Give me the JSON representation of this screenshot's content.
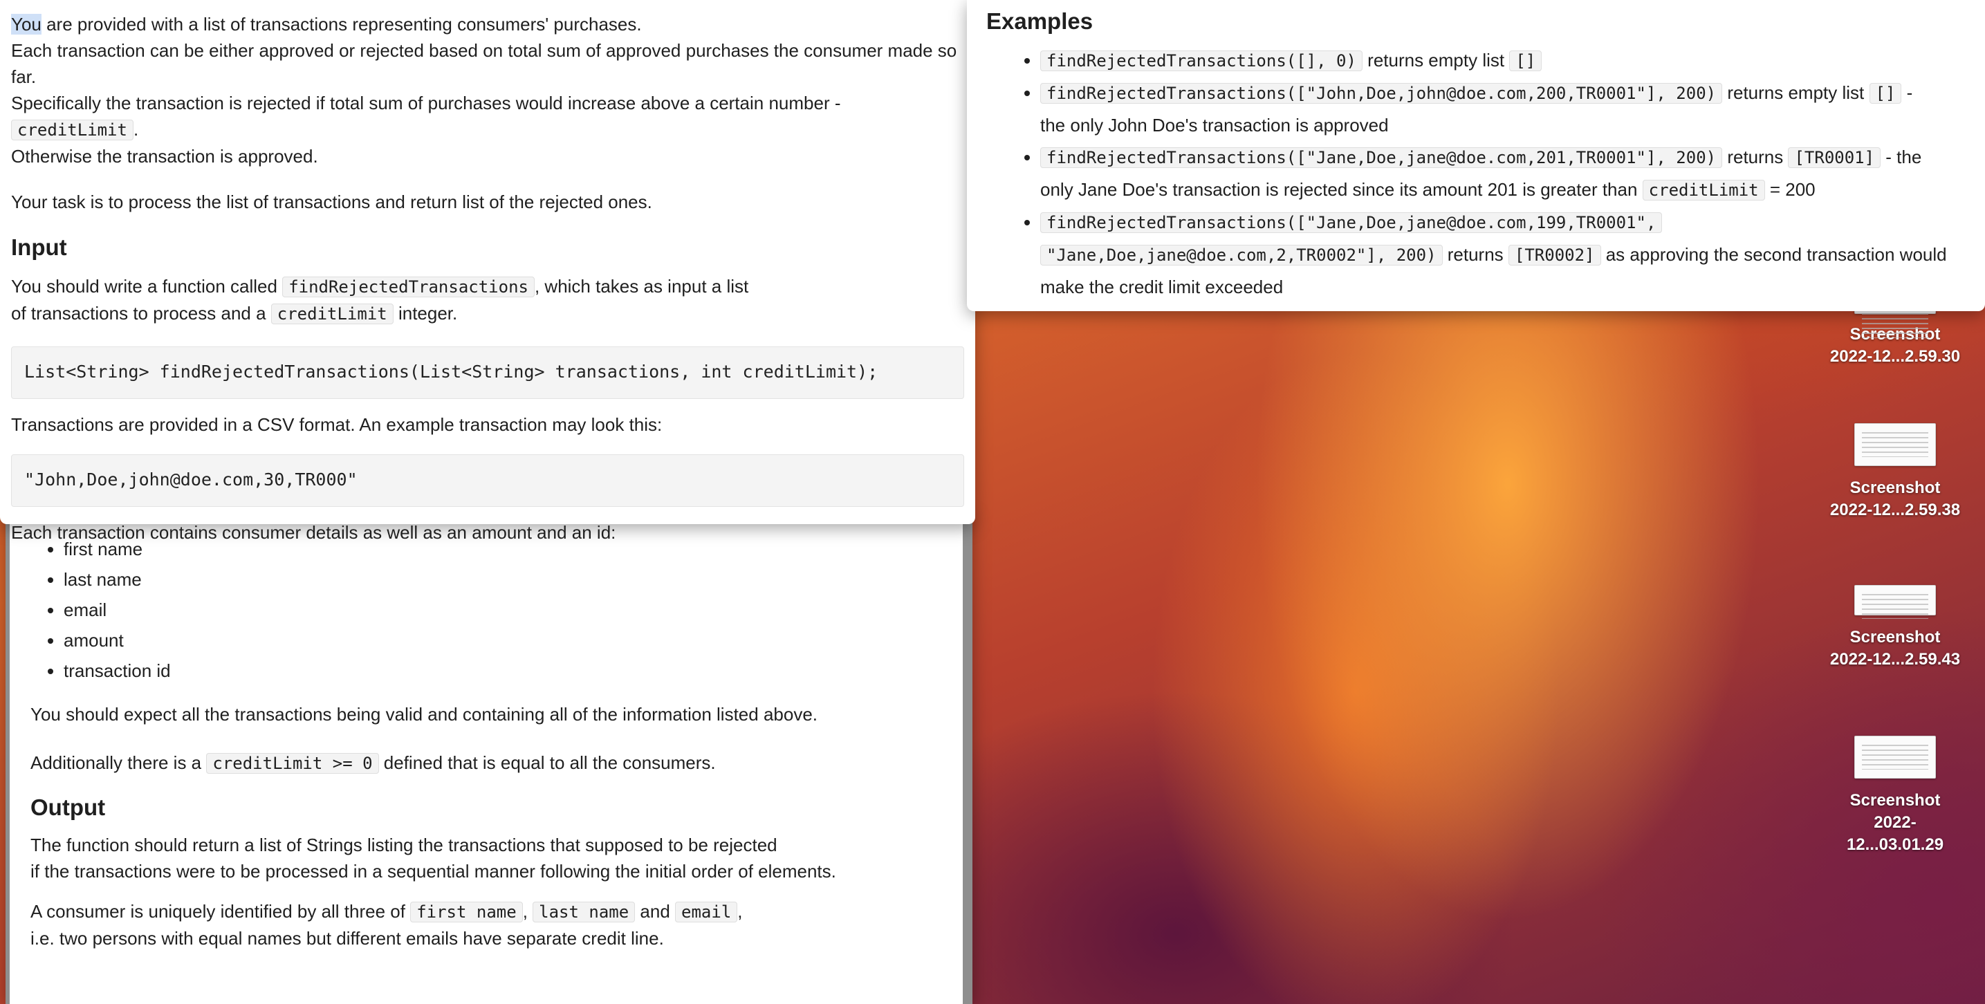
{
  "desktop": {
    "icons": [
      {
        "label_line1": "Screenshot",
        "label_line2": "2022-12...2.59.30"
      },
      {
        "label_line1": "Screenshot",
        "label_line2": "2022-12...2.59.38"
      },
      {
        "label_line1": "Screenshot",
        "label_line2": "2022-12...2.59.43"
      },
      {
        "label_line1": "Screenshot",
        "label_line2": "2022-12...03.01.29"
      }
    ]
  },
  "left": {
    "intro_you": "You",
    "intro_rest": " are provided with a list of transactions representing consumers' purchases.",
    "intro_line2": "Each transaction can be either approved or rejected based on total sum of approved purchases the consumer made so far.",
    "intro_line3_a": "Specifically the transaction is rejected if total sum of purchases would increase above a certain number - ",
    "intro_line3_code": "creditLimit",
    "intro_line3_b": ".",
    "intro_line4": "Otherwise the transaction is approved.",
    "task": "Your task is to process the list of transactions and return list of the rejected ones.",
    "input_heading": "Input",
    "input_line1_a": "You should write a function called ",
    "input_line1_code": "findRejectedTransactions",
    "input_line1_b": ", which takes as input a list",
    "input_line2_a": "of transactions to process and a ",
    "input_line2_code": "creditLimit",
    "input_line2_b": " integer.",
    "signature": "List<String> findRejectedTransactions(List<String> transactions, int creditLimit);",
    "csv_text": "Transactions are provided in a CSV format. An example transaction may look this:",
    "csv_example": "\"John,Doe,john@doe.com,30,TR000\"",
    "details_text": "Each transaction contains consumer details as well as an amount and an id:"
  },
  "back": {
    "fields": [
      "first name",
      "last name",
      "email",
      "amount",
      "transaction id"
    ],
    "valid_text": "You should expect all the transactions being valid and containing all of the information listed above.",
    "limit_a": "Additionally there is a ",
    "limit_code": "creditLimit >= 0",
    "limit_b": " defined that is equal to all the consumers.",
    "output_heading": "Output",
    "output_line1": "The function should return a list of Strings listing the transactions that supposed to be rejected",
    "output_line2": "if the transactions were to be processed in a sequential manner following the initial order of elements.",
    "consumer_a": "A consumer is uniquely identified by all three of ",
    "consumer_code1": "first name",
    "consumer_sep1": ", ",
    "consumer_code2": "last name",
    "consumer_and": " and ",
    "consumer_code3": "email",
    "consumer_b": ",",
    "consumer_line2": "i.e. two persons with equal names but different emails have separate credit line."
  },
  "right": {
    "heading": "Examples",
    "ex1_code": "findRejectedTransactions([], 0)",
    "ex1_text": " returns empty list ",
    "ex1_result": "[]",
    "ex2_code": "findRejectedTransactions([\"John,Doe,john@doe.com,200,TR0001\"], 200)",
    "ex2_text": " returns empty list ",
    "ex2_result": "[]",
    "ex2_tail_a": " -",
    "ex2_tail_b": "the only John Doe's transaction is approved",
    "ex3_code": "findRejectedTransactions([\"Jane,Doe,jane@doe.com,201,TR0001\"], 200)",
    "ex3_text": " returns ",
    "ex3_result": "[TR0001]",
    "ex3_tail_a": " - the",
    "ex3_tail_b": "only Jane Doe's transaction is rejected since its amount 201 is greater than ",
    "ex3_tail_code": "creditLimit",
    "ex3_tail_c": " = 200",
    "ex4_code_a": "findRejectedTransactions([\"Jane,Doe,jane@doe.com,199,TR0001\",",
    "ex4_code_b": "\"Jane,Doe,jane@doe.com,2,TR0002\"], 200)",
    "ex4_text": " returns ",
    "ex4_result": "[TR0002]",
    "ex4_tail_a": " as approving the second transaction would",
    "ex4_tail_b": "make the credit limit exceeded"
  }
}
